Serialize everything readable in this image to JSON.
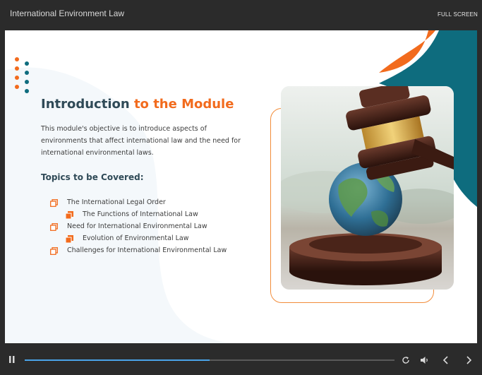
{
  "window": {
    "title": "International Environment Law",
    "fullscreen_label": "FULL SCREEN"
  },
  "slide": {
    "heading_part1": "Introduction ",
    "heading_part2": "to the Module",
    "description": "This module's objective is to introduce aspects of environments that affect international law and the need for international environmental laws.",
    "topics_title": "Topics to be Covered:",
    "topics": [
      {
        "label": "The International Legal Order",
        "level": 1
      },
      {
        "label": "The Functions of International Law",
        "level": 2
      },
      {
        "label": "Need for International Environmental Law",
        "level": 1
      },
      {
        "label": "Evolution of Environmental Law",
        "level": 2
      },
      {
        "label": "Challenges for International Environmental Law",
        "level": 1
      }
    ],
    "image": "gavel-on-globe"
  },
  "player": {
    "progress": 0.5,
    "icons": [
      "pause-icon",
      "replay-icon",
      "volume-icon",
      "previous-icon",
      "next-icon"
    ]
  },
  "colors": {
    "accent_orange": "#f26b1d",
    "teal": "#0e6c7e",
    "heading": "#2f4a57",
    "progress": "#4aa3e8"
  }
}
